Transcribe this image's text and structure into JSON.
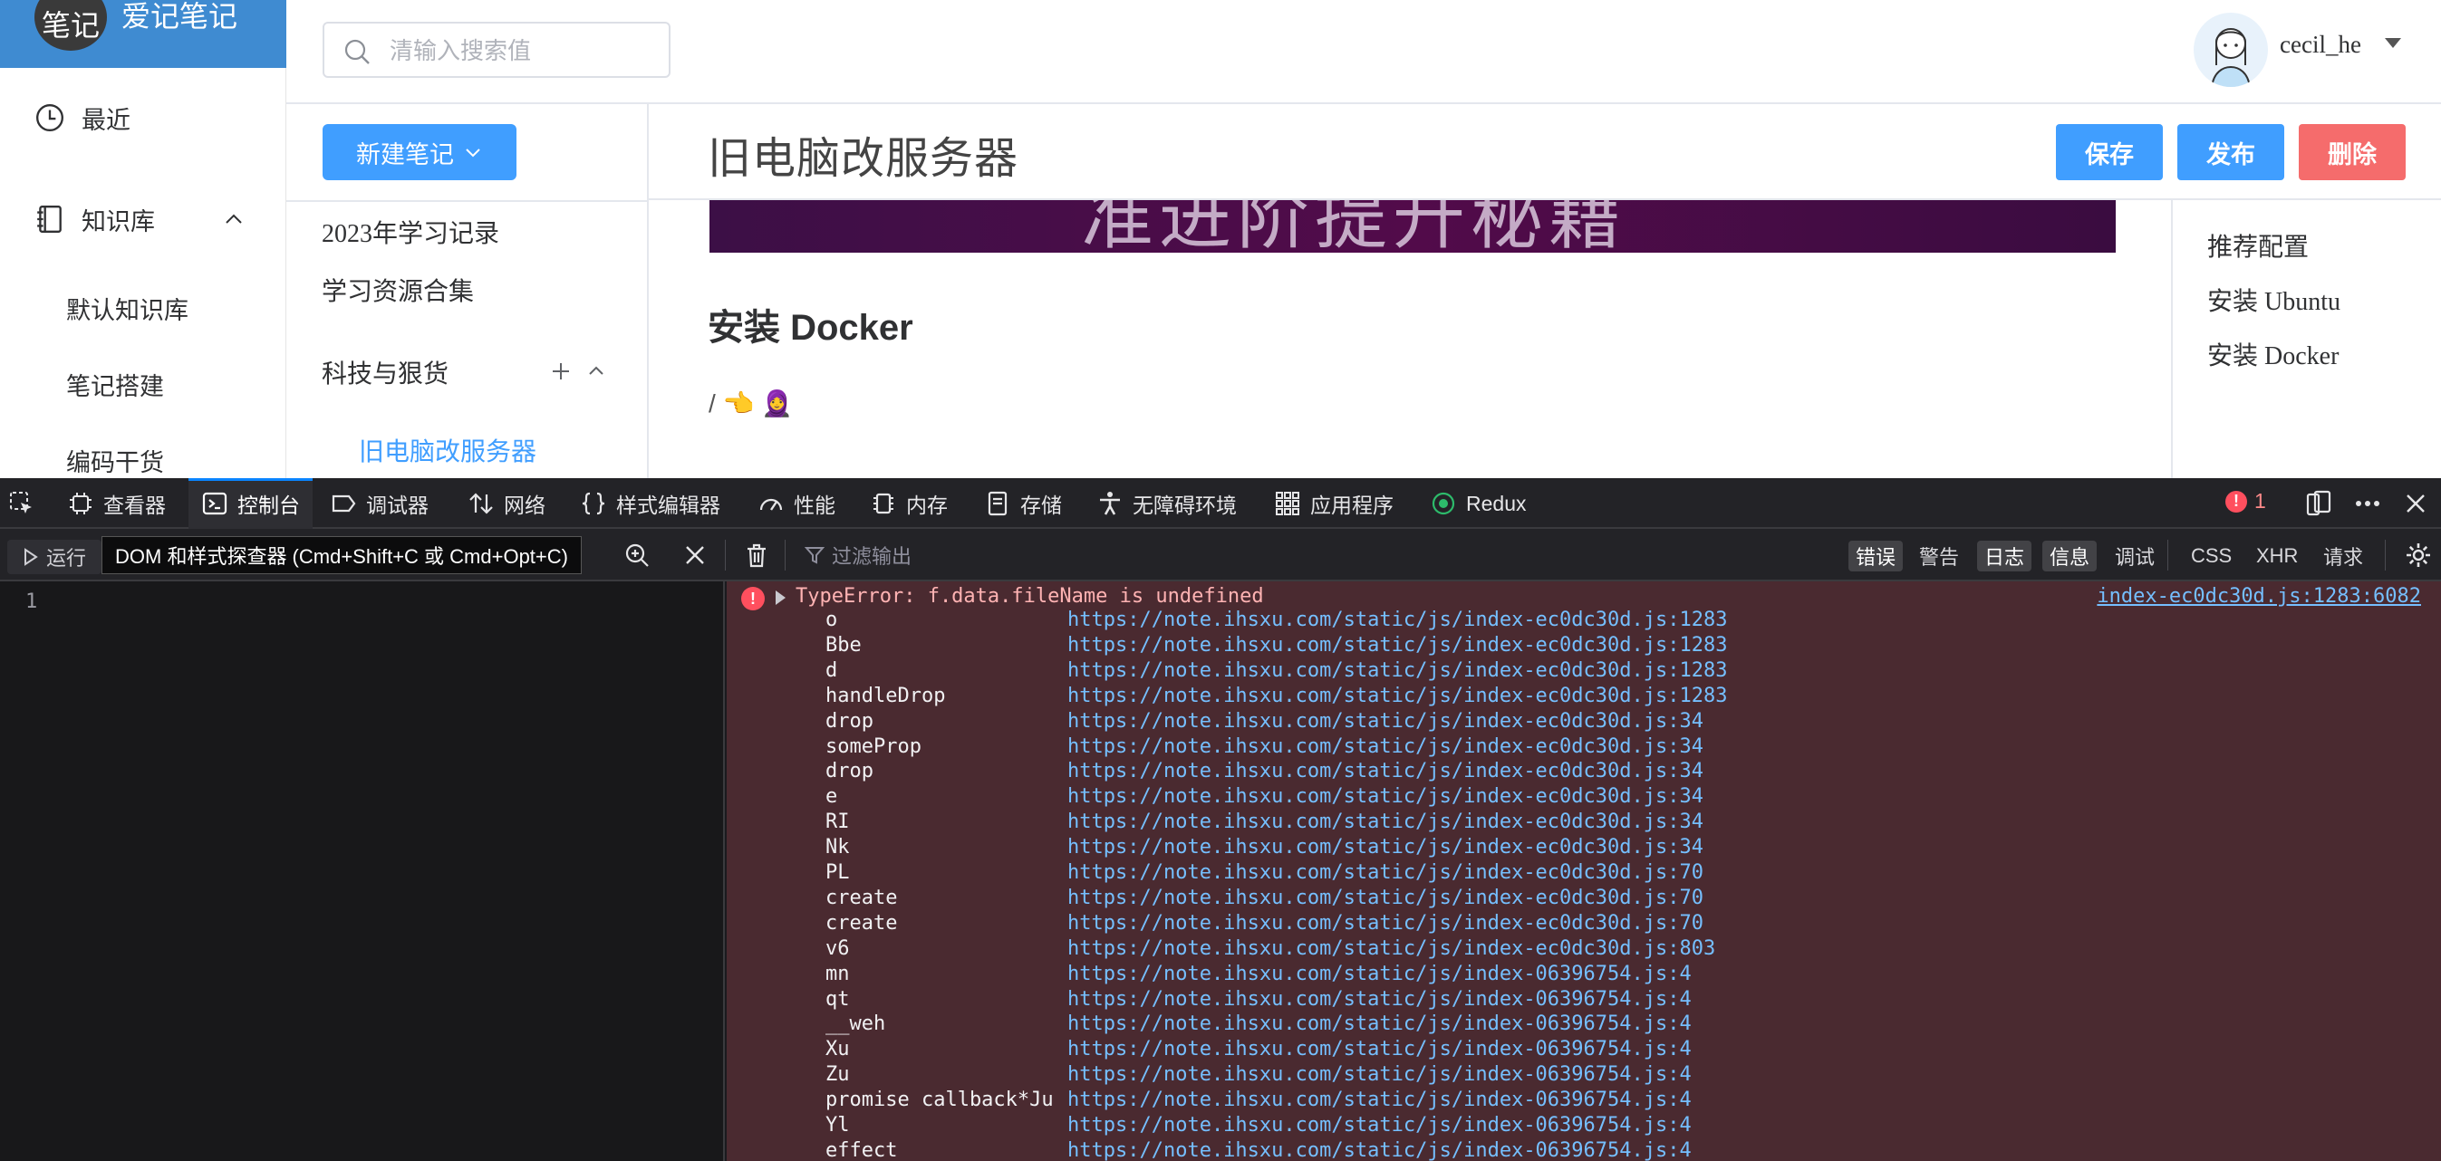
{
  "sidebar": {
    "logo_text": "笔记",
    "brand": "爱记笔记",
    "recent": "最近",
    "kb": "知识库",
    "kb_items": [
      "默认知识库",
      "笔记搭建",
      "编码干货"
    ]
  },
  "header": {
    "search_placeholder": "清输入搜索值",
    "username": "cecil_he"
  },
  "midpanel": {
    "new_button": "新建笔记",
    "items": [
      "2023年学习记录",
      "学习资源合集",
      "科技与狠货",
      "旧电脑改服务器"
    ]
  },
  "document": {
    "title": "旧电脑改服务器",
    "save": "保存",
    "publish": "发布",
    "delete": "删除",
    "banner_text": "准进阶提升秘籍",
    "heading": "安装 Docker",
    "line_text": "/ 👈 🧕"
  },
  "toc": [
    "推荐配置",
    "安装 Ubuntu",
    "安装 Docker"
  ],
  "devtools": {
    "tabs": [
      "查看器",
      "控制台",
      "调试器",
      "网络",
      "样式编辑器",
      "性能",
      "内存",
      "存储",
      "无障碍环境",
      "应用程序",
      "Redux"
    ],
    "error_count": "1",
    "run": "运行",
    "tooltip": "DOM 和样式探查器 (Cmd+Shift+C 或 Cmd+Opt+C)",
    "filter_placeholder": "过滤输出",
    "levels": [
      "错误",
      "警告",
      "日志",
      "信息",
      "调试"
    ],
    "requests": [
      "CSS",
      "XHR",
      "请求"
    ],
    "line_number": "1",
    "error": {
      "message": "TypeError: f.data.fileName is undefined",
      "location": "index-ec0dc30d.js:1283:6082",
      "stack": [
        {
          "fn": "o",
          "url": "https://note.ihsxu.com/static/js/index-ec0dc30d.js:1283"
        },
        {
          "fn": "Bbe",
          "url": "https://note.ihsxu.com/static/js/index-ec0dc30d.js:1283"
        },
        {
          "fn": "d",
          "url": "https://note.ihsxu.com/static/js/index-ec0dc30d.js:1283"
        },
        {
          "fn": "handleDrop",
          "url": "https://note.ihsxu.com/static/js/index-ec0dc30d.js:1283"
        },
        {
          "fn": "drop",
          "url": "https://note.ihsxu.com/static/js/index-ec0dc30d.js:34"
        },
        {
          "fn": "someProp",
          "url": "https://note.ihsxu.com/static/js/index-ec0dc30d.js:34"
        },
        {
          "fn": "drop",
          "url": "https://note.ihsxu.com/static/js/index-ec0dc30d.js:34"
        },
        {
          "fn": "e",
          "url": "https://note.ihsxu.com/static/js/index-ec0dc30d.js:34"
        },
        {
          "fn": "RI",
          "url": "https://note.ihsxu.com/static/js/index-ec0dc30d.js:34"
        },
        {
          "fn": "Nk",
          "url": "https://note.ihsxu.com/static/js/index-ec0dc30d.js:34"
        },
        {
          "fn": "PL",
          "url": "https://note.ihsxu.com/static/js/index-ec0dc30d.js:70"
        },
        {
          "fn": "create",
          "url": "https://note.ihsxu.com/static/js/index-ec0dc30d.js:70"
        },
        {
          "fn": "create",
          "url": "https://note.ihsxu.com/static/js/index-ec0dc30d.js:70"
        },
        {
          "fn": "v6",
          "url": "https://note.ihsxu.com/static/js/index-ec0dc30d.js:803"
        },
        {
          "fn": "mn",
          "url": "https://note.ihsxu.com/static/js/index-06396754.js:4"
        },
        {
          "fn": "qt",
          "url": "https://note.ihsxu.com/static/js/index-06396754.js:4"
        },
        {
          "fn": "__weh",
          "url": "https://note.ihsxu.com/static/js/index-06396754.js:4"
        },
        {
          "fn": "Xu",
          "url": "https://note.ihsxu.com/static/js/index-06396754.js:4"
        },
        {
          "fn": "Zu",
          "url": "https://note.ihsxu.com/static/js/index-06396754.js:4"
        },
        {
          "fn": "promise callback*Ju",
          "url": "https://note.ihsxu.com/static/js/index-06396754.js:4"
        },
        {
          "fn": "Yl",
          "url": "https://note.ihsxu.com/static/js/index-06396754.js:4"
        },
        {
          "fn": "effect",
          "url": "https://note.ihsxu.com/static/js/index-06396754.js:4"
        }
      ]
    }
  },
  "colors": {
    "brand_blue": "#3f8bd1",
    "primary": "#409eff",
    "danger": "#f56c6c",
    "devtools_bg": "#1b1b1f",
    "console_error_bg": "#4a2a30",
    "link": "#75bfff"
  }
}
